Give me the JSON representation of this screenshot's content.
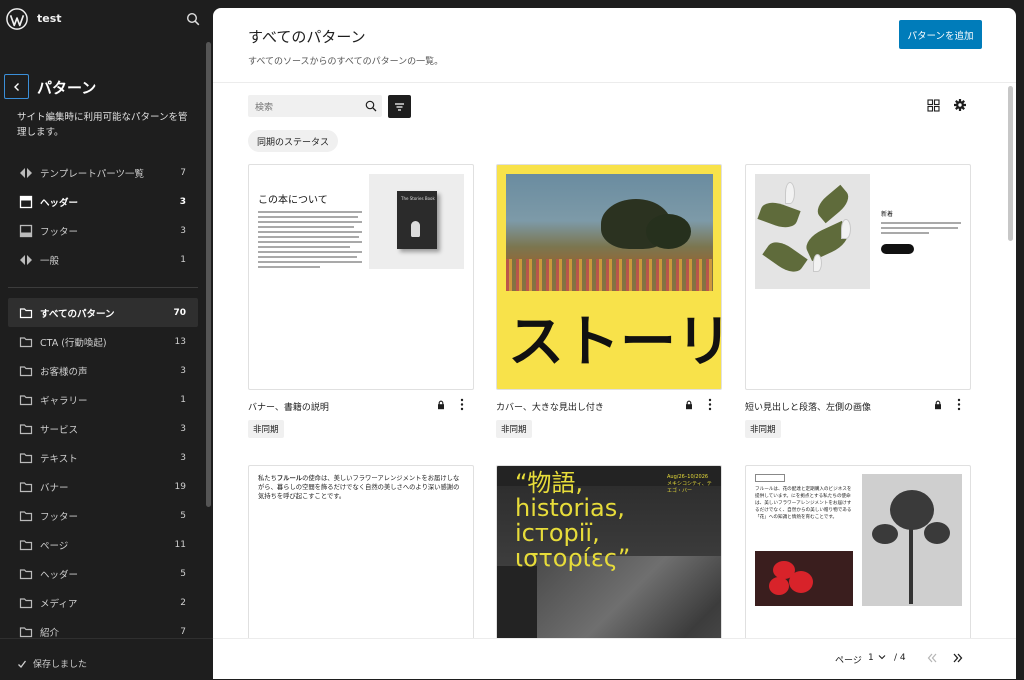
{
  "site": {
    "name": "test"
  },
  "sidebar": {
    "title": "パターン",
    "description": "サイト編集時に利用可能なパターンを管理します。",
    "template_parts": [
      {
        "label": "テンプレートパーツ一覧",
        "count": "7",
        "icon": "symbol-icon"
      },
      {
        "label": "ヘッダー",
        "count": "3",
        "icon": "header-icon"
      },
      {
        "label": "フッター",
        "count": "3",
        "icon": "footer-icon"
      },
      {
        "label": "一般",
        "count": "1",
        "icon": "symbol-icon"
      }
    ],
    "categories": [
      {
        "label": "すべてのパターン",
        "count": "70"
      },
      {
        "label": "CTA (行動喚起)",
        "count": "13"
      },
      {
        "label": "お客様の声",
        "count": "3"
      },
      {
        "label": "ギャラリー",
        "count": "1"
      },
      {
        "label": "サービス",
        "count": "3"
      },
      {
        "label": "テキスト",
        "count": "3"
      },
      {
        "label": "バナー",
        "count": "19"
      },
      {
        "label": "フッター",
        "count": "5"
      },
      {
        "label": "ページ",
        "count": "11"
      },
      {
        "label": "ヘッダー",
        "count": "5"
      },
      {
        "label": "メディア",
        "count": "2"
      },
      {
        "label": "紹介",
        "count": "7"
      }
    ],
    "saved_label": "保存しました"
  },
  "main": {
    "title": "すべてのパターン",
    "description": "すべてのソースからのすべてのパターンの一覧。",
    "add_button": "パターンを追加",
    "search_placeholder": "検索",
    "sync_filter": "同期のステータス",
    "cards": [
      {
        "name": "バナー、書籍の説明",
        "badge": "非同期",
        "heading": "この本について",
        "book_title": "The Stories Book"
      },
      {
        "name": "カバー、大きな見出し付き",
        "badge": "非同期",
        "big_text": "ストーリ"
      },
      {
        "name": "短い見出しと段落、左側の画像",
        "badge": "非同期",
        "heading": "新着"
      },
      {
        "text_intro": "私たち",
        "text_bold": "フルール",
        "text_rest": "の使命は、美しいフラワーアレンジメントをお届けしながら、暮らしの空間を飾るだけでなく自然の美しさへのより深い感謝の気持ちを呼び起こすことです。"
      },
      {
        "quote_lines": [
          "“物語,",
          "historias,",
          "іcторії,",
          "ιστορίες”"
        ],
        "event_lines": [
          "Aug/26–10/2026",
          "メキシコシティ、テ",
          "エゴ・バー"
        ]
      },
      {
        "body_text": "フルールは、花の配達と定期購入のビジネスを提供しています。にを拠点とする私たちの使命は、美しいフラワーアレンジメントをお届けするだけでなく、自然からの美しい贈り物である「花」への知識と情熱を育むことです。"
      }
    ],
    "pagination": {
      "label": "ページ",
      "current": "1",
      "total": "/ 4"
    }
  },
  "colors": {
    "accent": "#007cba",
    "sidebar_bg": "#1e1e1e",
    "cover_yellow": "#f8e24a",
    "quote_yellow": "#e7dc3a"
  }
}
